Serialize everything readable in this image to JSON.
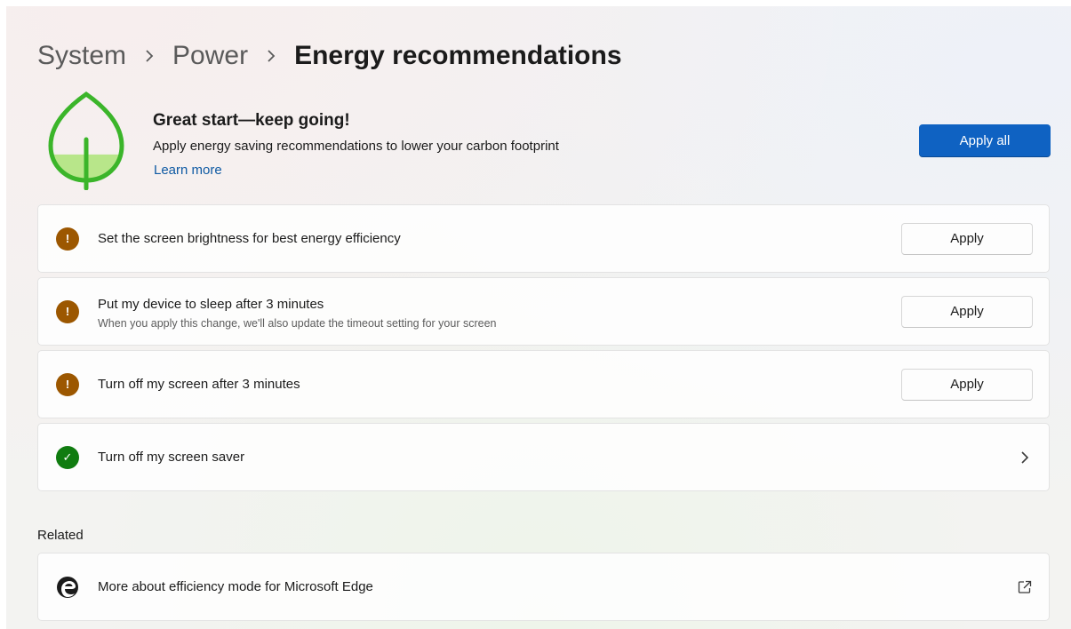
{
  "breadcrumb": {
    "items": [
      "System",
      "Power"
    ],
    "current": "Energy recommendations"
  },
  "hero": {
    "title": "Great start—keep going!",
    "subtitle": "Apply energy saving recommendations to lower your carbon footprint",
    "link": "Learn more",
    "apply_all_label": "Apply all",
    "leaf_fill_level": 0.3
  },
  "recommendations": [
    {
      "title": "Set the screen brightness for best energy efficiency",
      "status": "warning",
      "status_glyph": "!",
      "action": "Apply"
    },
    {
      "title": "Put my device to sleep after 3 minutes",
      "description": "When you apply this change, we'll also update the timeout setting for your screen",
      "status": "warning",
      "status_glyph": "!",
      "action": "Apply"
    },
    {
      "title": "Turn off my screen after 3 minutes",
      "status": "warning",
      "status_glyph": "!",
      "action": "Apply"
    },
    {
      "title": "Turn off my screen saver",
      "status": "done",
      "status_glyph": "✓"
    }
  ],
  "related": {
    "heading": "Related",
    "items": [
      {
        "title": "More about efficiency mode for Microsoft Edge",
        "icon": "edge-icon",
        "trailing_icon": "open-external-icon"
      }
    ]
  },
  "colors": {
    "accent": "#0f62c2",
    "warning": "#9c5700",
    "success": "#107c10",
    "leaf_green": "#3bb52a",
    "link": "#0f5aa3"
  }
}
